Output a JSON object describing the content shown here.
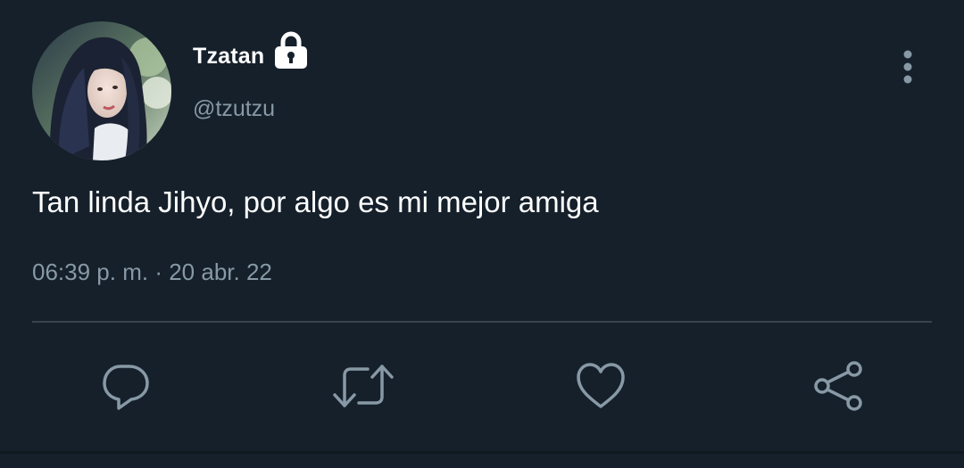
{
  "user": {
    "display_name": "Tzatan",
    "handle": "@tzutzu",
    "avatar_icon": "profile-photo",
    "protected_icon": "lock-icon"
  },
  "tweet": {
    "text": "Tan linda Jihyo, por algo es mi mejor amiga",
    "time": "06:39 p. m.",
    "separator": "·",
    "date": "20 abr. 22"
  },
  "actions": [
    {
      "icon": "reply-icon"
    },
    {
      "icon": "retweet-icon"
    },
    {
      "icon": "like-icon"
    },
    {
      "icon": "share-icon"
    }
  ],
  "menu_icon": "more-options-icon",
  "colors": {
    "background": "#15202b",
    "primary_text": "#ffffff",
    "secondary_text": "#8899a6",
    "divider": "#38444d"
  }
}
